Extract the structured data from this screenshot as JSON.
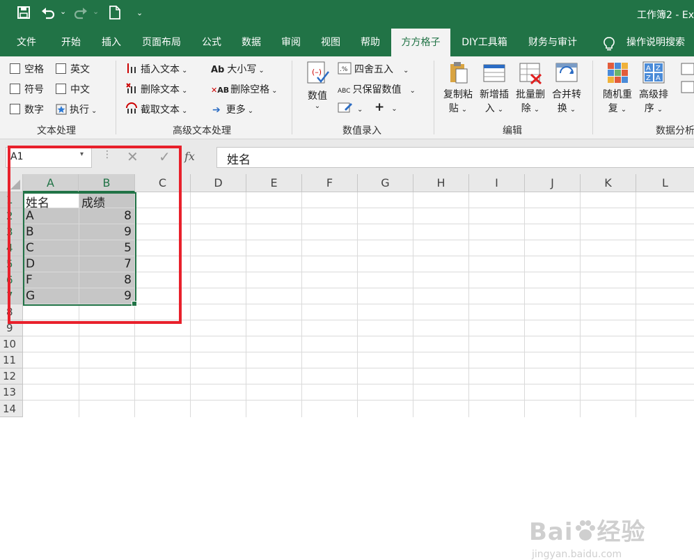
{
  "titlebar": {
    "title": "工作簿2  -  Ex",
    "qat": {
      "save_icon": "save-icon",
      "undo_icon": "undo-icon",
      "redo_icon": "redo-icon",
      "new_icon": "new-file-icon",
      "customize_icon": "customize-qat-icon"
    }
  },
  "tabs": [
    "文件",
    "开始",
    "插入",
    "页面布局",
    "公式",
    "数据",
    "审阅",
    "视图",
    "帮助",
    "方方格子",
    "DIY工具箱",
    "财务与审计",
    "操作说明搜索"
  ],
  "active_tab": "方方格子",
  "ribbon": {
    "text_processing": {
      "group_label": "文本处理",
      "checkboxes": [
        "空格",
        "英文",
        "符号",
        "中文",
        "数字"
      ],
      "execute": "执行"
    },
    "advanced_text": {
      "group_label": "高级文本处理",
      "items": [
        "插入文本",
        "删除文本",
        "截取文本",
        "大小写",
        "删除空格",
        "更多"
      ]
    },
    "number_entry": {
      "group_label": "数值录入",
      "big_button": "数值",
      "items": [
        "四舍五入",
        "只保留数值"
      ],
      "plus": "+"
    },
    "edit": {
      "group_label": "编辑",
      "buttons": [
        {
          "line1": "复制粘",
          "line2": "贴"
        },
        {
          "line1": "新增插",
          "line2": "入"
        },
        {
          "line1": "批量删",
          "line2": "除"
        },
        {
          "line1": "合并转",
          "line2": "换"
        }
      ]
    },
    "data_analysis": {
      "group_label": "数据分析",
      "buttons": [
        {
          "line1": "随机重",
          "line2": "复"
        },
        {
          "line1": "高级排",
          "line2": "序"
        }
      ]
    }
  },
  "formula_bar": {
    "name_box": "A1",
    "cancel_symbol": "✕",
    "enter_symbol": "✓",
    "fx": "fx",
    "content": "姓名"
  },
  "sheet": {
    "columns": [
      "A",
      "B",
      "C",
      "D",
      "E",
      "F",
      "G",
      "H",
      "I",
      "J",
      "K",
      "L"
    ],
    "rows": [
      "1",
      "2",
      "3",
      "4",
      "5",
      "6",
      "7",
      "8",
      "9",
      "10",
      "11",
      "12",
      "13",
      "14"
    ],
    "table": [
      [
        "姓名",
        "成绩"
      ],
      [
        "A",
        "8"
      ],
      [
        "B",
        "9"
      ],
      [
        "C",
        "5"
      ],
      [
        "D",
        "7"
      ],
      [
        "F",
        "8"
      ],
      [
        "G",
        "9"
      ]
    ],
    "selection": "A1:G7"
  },
  "watermark": {
    "brand": "Bai",
    "brand2": "经验",
    "url": "jingyan.baidu.com"
  },
  "colors": {
    "accent": "#217346",
    "highlight": "#e8202b",
    "selection": "#c6c6c6"
  }
}
